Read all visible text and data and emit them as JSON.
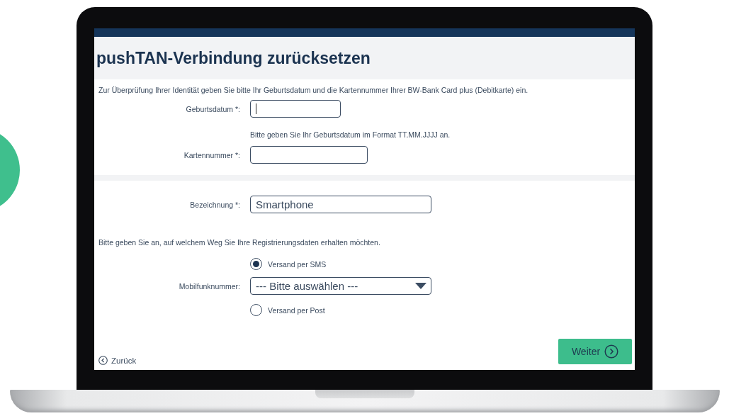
{
  "header": {
    "title": "pushTAN-Verbindung zurücksetzen"
  },
  "intro": "Zur Überprüfung Ihrer Identität geben Sie bitte Ihr Geburtsdatum und die Kartennummer Ihrer BW-Bank Card plus (Debitkarte) ein.",
  "identity_fields": [
    {
      "label": "Geburtsdatum *:",
      "focused": true,
      "hint": "Bitte geben Sie Ihr Geburtsdatum im Format TT.MM.JJJJ an."
    },
    {
      "label": "Kartennummer *:",
      "focused": false
    }
  ],
  "designation": {
    "label": "Bezeichnung *:",
    "value": "Smartphone"
  },
  "delivery": {
    "prompt": "Bitte geben Sie an, auf welchem Weg Sie Ihre Registrierungsdaten erhalten möchten.",
    "options": [
      {
        "label": "Versand per SMS",
        "selected": true
      },
      {
        "label": "Versand per Post",
        "selected": false
      }
    ],
    "mobile_number": {
      "label": "Mobilfunknummer:",
      "value": "--- Bitte auswählen ---"
    }
  },
  "back_link": "Zurück",
  "next_button": "Weiter"
}
